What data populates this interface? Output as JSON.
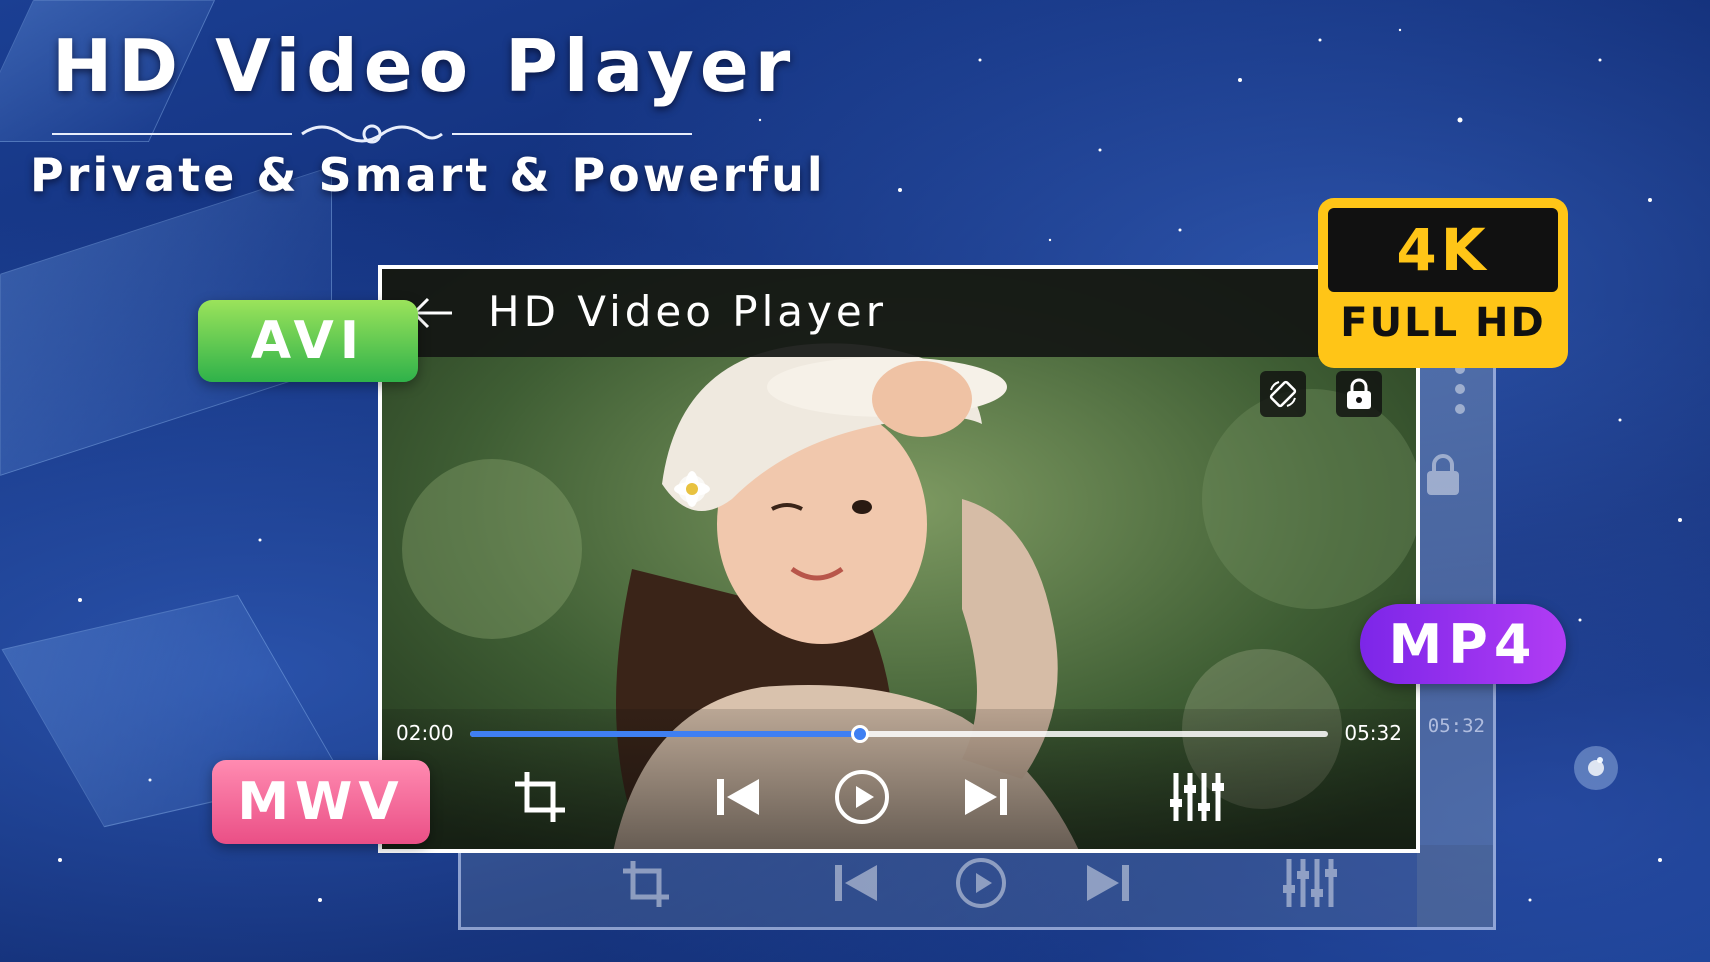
{
  "headline": "HD Video Player",
  "tagline": "Private & Smart & Powerful",
  "player": {
    "title": "HD Video Player",
    "current_time": "02:00",
    "duration": "05:32",
    "progress": 0.455
  },
  "ghost_player": {
    "duration": "05:32"
  },
  "badges": {
    "avi": "AVI",
    "mwv": "MWV",
    "mp4": "MP4",
    "resolution_top": "4K",
    "resolution_bottom": "FULL HD"
  },
  "icons": [
    "back-arrow-icon",
    "rotate-icon",
    "lock-icon",
    "crop-icon",
    "previous-icon",
    "play-icon",
    "next-icon",
    "equalizer-icon",
    "more-vertical-icon"
  ],
  "colors": {
    "accent_blue": "#3f7ff2",
    "avi_green": "#2fb24a",
    "mwv_pink": "#ea4f86",
    "mp4_purple": "#9a33ee",
    "hd_yellow": "#ffc517"
  }
}
